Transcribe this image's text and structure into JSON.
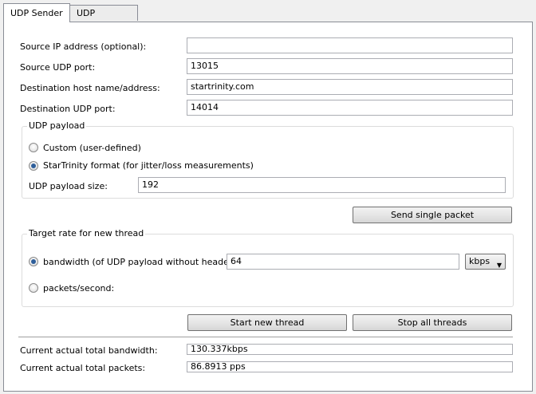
{
  "tabs": [
    {
      "label": "UDP Sender",
      "active": true
    },
    {
      "label": "UDP Receiver",
      "active": false
    }
  ],
  "form": {
    "source_ip_label": "Source IP address (optional):",
    "source_ip_value": "",
    "source_port_label": "Source UDP port:",
    "source_port_value": "13015",
    "dest_host_label": "Destination host name/address:",
    "dest_host_value": "startrinity.com",
    "dest_port_label": "Destination UDP port:",
    "dest_port_value": "14014"
  },
  "payload": {
    "title": "UDP payload",
    "custom_label": "Custom (user-defined)",
    "startrinity_label": "StarTrinity format (for jitter/loss measurements)",
    "selected": "startrinity",
    "size_label": "UDP payload size:",
    "size_value": "192"
  },
  "send_single_label": "Send single packet",
  "rate": {
    "title": "Target rate for new thread",
    "bandwidth_label": "bandwidth (of UDP payload without headers):",
    "bandwidth_value": "64",
    "unit": "kbps",
    "pps_label": "packets/second:",
    "selected": "bandwidth"
  },
  "buttons": {
    "start": "Start new thread",
    "stop": "Stop all threads"
  },
  "status": {
    "bandwidth_label": "Current actual total bandwidth:",
    "bandwidth_value": "130.337kbps",
    "packets_label": "Current actual total packets:",
    "packets_value": "86.8913 pps"
  },
  "colors": {
    "radio_dot": "#2e5e9a",
    "panel_border": "#898c95"
  }
}
